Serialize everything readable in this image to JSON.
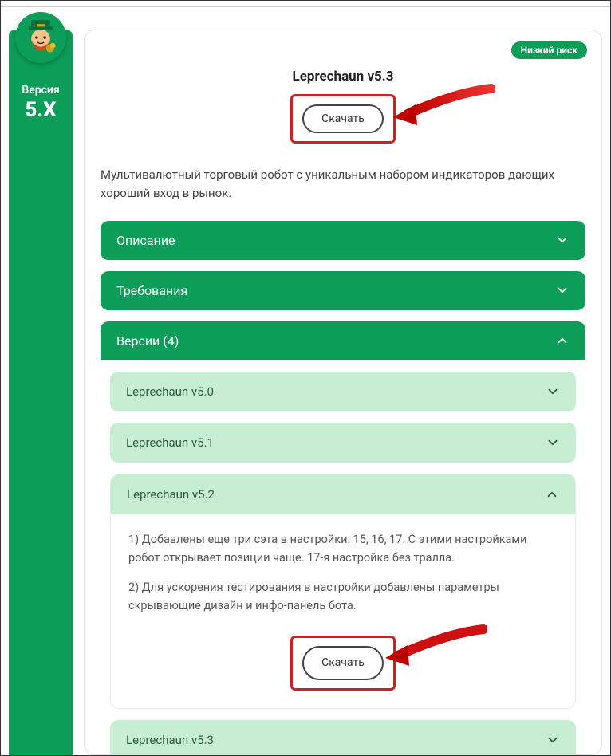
{
  "sidebar": {
    "label": "Версия",
    "version": "5.X"
  },
  "header": {
    "risk_badge": "Низкий риск",
    "title": "Leprechaun v5.3",
    "download_label": "Скачать"
  },
  "description": "Мультивалютный торговый робот с уникальным набором индикаторов дающих хороший вход в рынок.",
  "accordions": {
    "description_label": "Описание",
    "requirements_label": "Требования",
    "versions_label": "Версии (4)"
  },
  "versions": [
    {
      "name": "Leprechaun v5.0",
      "open": false
    },
    {
      "name": "Leprechaun v5.1",
      "open": false
    },
    {
      "name": "Leprechaun v5.2",
      "open": true,
      "notes": [
        "1) Добавлены еще три сэта в настройки: 15, 16, 17. С этими настройками робот открывает позиции чаще. 17-я настройка без тралла.",
        "2) Для ускорения тестирования в настройки добавлены параметры скрывающие дизайн и инфо-панель бота."
      ],
      "download_label": "Скачать"
    },
    {
      "name": "Leprechaun v5.3",
      "open": false
    }
  ]
}
